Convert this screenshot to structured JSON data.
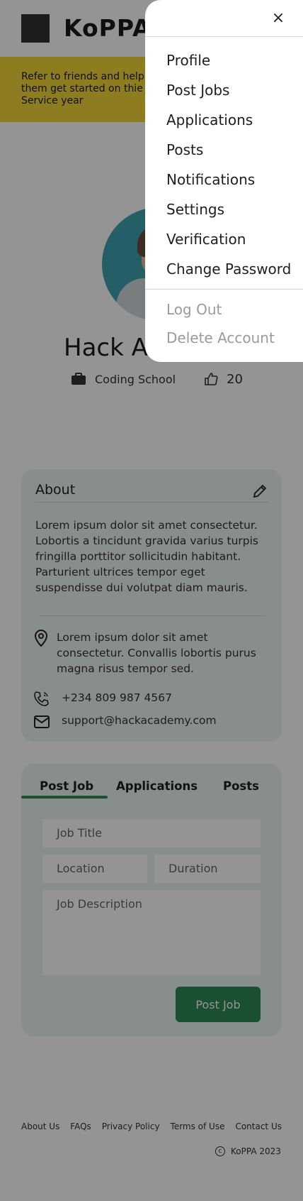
{
  "header": {
    "brand": "KoPPA"
  },
  "banner": {
    "text": "Refer to friends and help them get started on thie Service year"
  },
  "profile": {
    "name": "Hack Academy",
    "school": "Coding School",
    "likes": "20"
  },
  "about": {
    "title": "About",
    "description": "Lorem ipsum dolor sit amet consectetur. Lobortis a tincidunt gravida varius turpis fringilla porttitor sollicitudin habitant. Parturient ultrices tempor eget suspendisse dui volutpat diam mauris.",
    "address": "Lorem ipsum dolor sit amet consectetur. Convallis lobortis purus magna risus tempor sed.",
    "phone": "+234 809 987 4567",
    "email": "support@hackacademy.com"
  },
  "tabs": [
    {
      "label": "Post Job",
      "active": true
    },
    {
      "label": "Applications",
      "active": false
    },
    {
      "label": "Posts",
      "active": false
    }
  ],
  "form": {
    "job_title_placeholder": "Job Title",
    "location_placeholder": "Location",
    "duration_placeholder": "Duration",
    "description_placeholder": "Job Description",
    "submit_label": "Post Job"
  },
  "footer": {
    "links": [
      "About Us",
      "FAQs",
      "Privacy Policy",
      "Terms of Use",
      "Contact Us"
    ],
    "copyright": "KoPPA 2023"
  },
  "menu": {
    "close_icon": "×",
    "items": [
      "Profile",
      "Post Jobs",
      "Applications",
      "Posts",
      "Notifications",
      "Settings",
      "Verification",
      "Change Password"
    ],
    "secondary": [
      "Log Out",
      "Delete Account"
    ]
  },
  "colors": {
    "accent": "#2e8b57",
    "banner": "#f4d639",
    "card": "#eaf4ef"
  }
}
